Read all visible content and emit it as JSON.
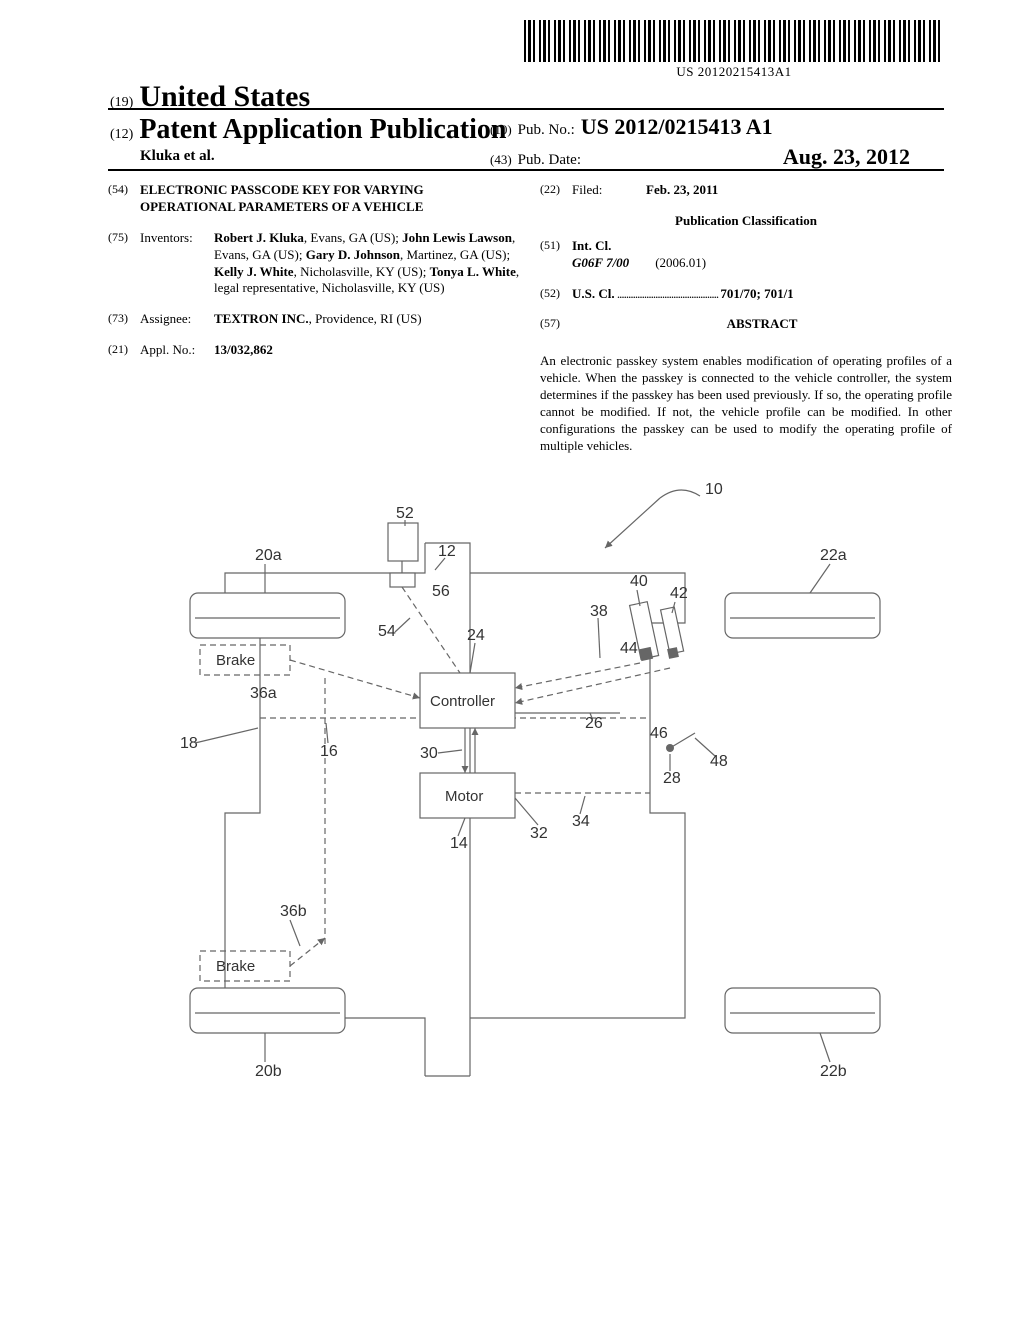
{
  "barcode_number": "US 20120215413A1",
  "header": {
    "country_code": "(19)",
    "country": "United States",
    "pub_type_code": "(12)",
    "pub_type": "Patent Application Publication",
    "author_line": "Kluka et al.",
    "pub_no_code": "(10)",
    "pub_no_label": "Pub. No.:",
    "pub_no_value": "US 2012/0215413 A1",
    "pub_date_code": "(43)",
    "pub_date_label": "Pub. Date:",
    "pub_date_value": "Aug. 23, 2012"
  },
  "left_col": {
    "title_code": "(54)",
    "title": "ELECTRONIC PASSCODE KEY FOR VARYING OPERATIONAL PARAMETERS OF A VEHICLE",
    "inventors_code": "(75)",
    "inventors_label": "Inventors:",
    "inventors_html": "Robert J. Kluka, Evans, GA (US); John Lewis Lawson, Evans, GA (US); Gary D. Johnson, Martinez, GA (US); Kelly J. White, Nicholasville, KY (US); Tonya L. White, legal representative, Nicholasville, KY (US)",
    "assignee_code": "(73)",
    "assignee_label": "Assignee:",
    "assignee": "TEXTRON INC., Providence, RI (US)",
    "appl_no_code": "(21)",
    "appl_no_label": "Appl. No.:",
    "appl_no": "13/032,862"
  },
  "right_col": {
    "filed_code": "(22)",
    "filed_label": "Filed:",
    "filed": "Feb. 23, 2011",
    "classification_heading": "Publication Classification",
    "intcl_code": "(51)",
    "intcl_label": "Int. Cl.",
    "intcl_class": "G06F 7/00",
    "intcl_date": "(2006.01)",
    "uscl_code": "(52)",
    "uscl_label": "U.S. Cl.",
    "uscl_value": "701/70; 701/1",
    "abstract_code": "(57)",
    "abstract_heading": "ABSTRACT",
    "abstract_text": "An electronic passkey system enables modification of operating profiles of a vehicle. When the passkey is connected to the vehicle controller, the system determines if the passkey has been used previously. If so, the operating profile cannot be modified. If not, the vehicle profile can be modified. In other configurations the passkey can be used to modify the operating profile of multiple vehicles."
  },
  "figure": {
    "refs": {
      "r10": "10",
      "r12": "12",
      "r14": "14",
      "r16": "16",
      "r18": "18",
      "r20a": "20a",
      "r20b": "20b",
      "r22a": "22a",
      "r22b": "22b",
      "r24": "24",
      "r26": "26",
      "r28": "28",
      "r30": "30",
      "r32": "32",
      "r34": "34",
      "r36a": "36a",
      "r36b": "36b",
      "r38": "38",
      "r40": "40",
      "r42": "42",
      "r44": "44",
      "r46": "46",
      "r48": "48",
      "r52": "52",
      "r54": "54",
      "r56": "56"
    },
    "labels": {
      "controller": "Controller",
      "motor": "Motor",
      "brake": "Brake"
    }
  }
}
